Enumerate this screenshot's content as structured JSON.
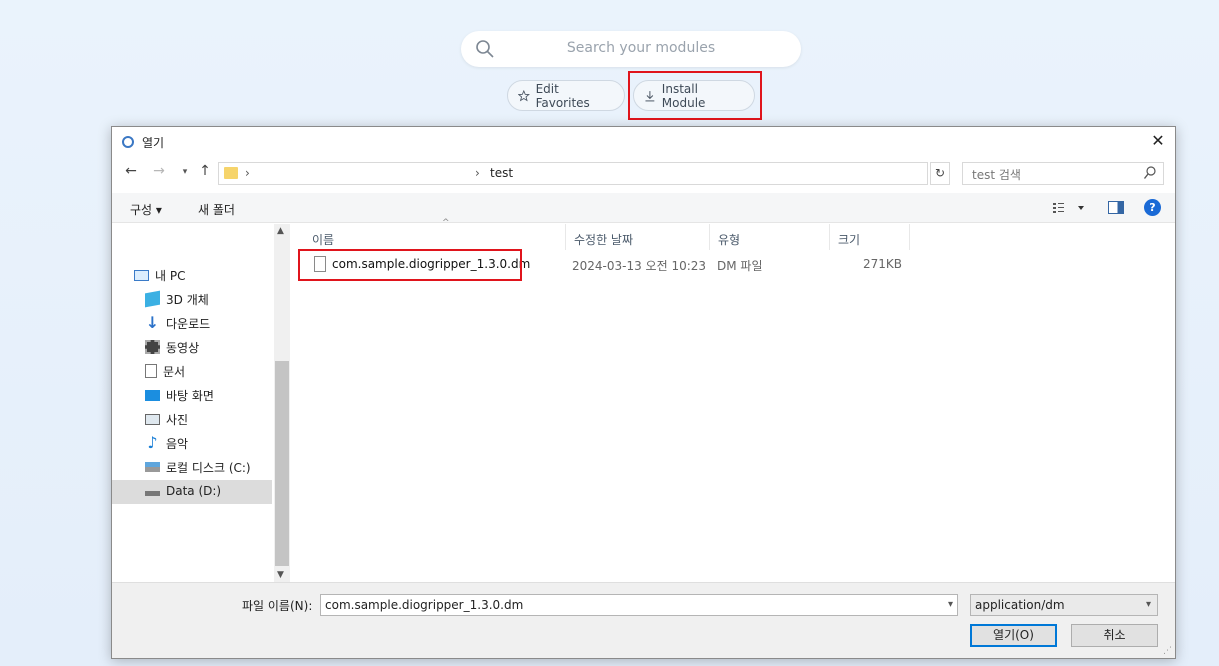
{
  "app": {
    "search_placeholder": "Search your modules",
    "edit_favorites_label": "Edit Favorites",
    "install_module_label": "Install Module"
  },
  "dialog": {
    "title": "열기",
    "close_glyph": "✕",
    "address": {
      "crumb": "test",
      "search_placeholder": "test 검색"
    },
    "toolbar": {
      "organize_label": "구성 ▾",
      "new_folder_label": "새 폴더",
      "help_label": "?"
    },
    "nav_items": [
      {
        "label": "내 PC",
        "icon": "pc-icon"
      },
      {
        "label": "3D 개체",
        "icon": "3d-objects-icon"
      },
      {
        "label": "다운로드",
        "icon": "downloads-icon"
      },
      {
        "label": "동영상",
        "icon": "videos-icon"
      },
      {
        "label": "문서",
        "icon": "documents-icon"
      },
      {
        "label": "바탕 화면",
        "icon": "desktop-icon"
      },
      {
        "label": "사진",
        "icon": "pictures-icon"
      },
      {
        "label": "음악",
        "icon": "music-icon"
      },
      {
        "label": "로컬 디스크 (C:)",
        "icon": "local-disk-icon"
      },
      {
        "label": "Data (D:)",
        "icon": "drive-icon",
        "selected": true
      }
    ],
    "columns": {
      "name": "이름",
      "date": "수정한 날짜",
      "type": "유형",
      "size": "크기"
    },
    "files": [
      {
        "name": "com.sample.diogripper_1.3.0.dm",
        "date": "2024-03-13 오전 10:23",
        "type": "DM 파일",
        "size": "271KB"
      }
    ],
    "bottom": {
      "filename_label": "파일 이름(N):",
      "filename_value": "com.sample.diogripper_1.3.0.dm",
      "filetype_value": "application/dm",
      "open_label": "열기(O)",
      "cancel_label": "취소"
    }
  },
  "colors": {
    "highlight": "#e0141c",
    "accent": "#0078d7"
  }
}
